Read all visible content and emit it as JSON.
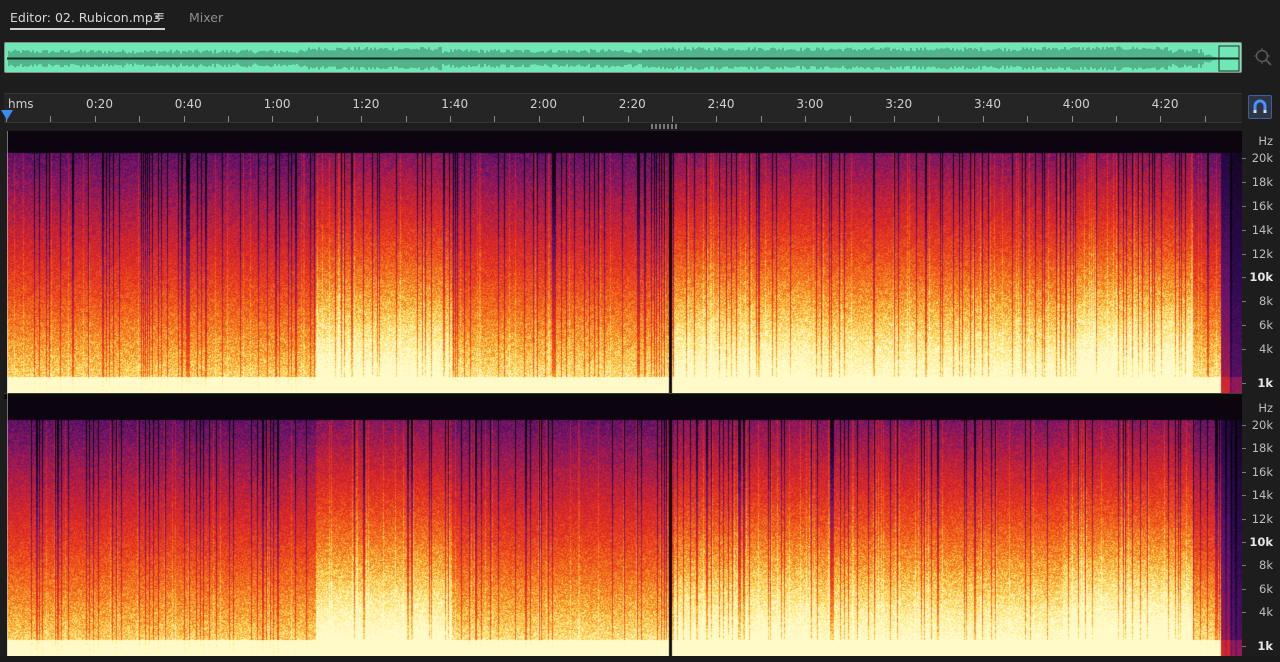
{
  "tabs": {
    "editor_label": "Editor: 02. Rubicon.mp3",
    "menu_glyph": "≡",
    "mixer_label": "Mixer"
  },
  "overview": {
    "color": "#6fe8b6",
    "zoom_icon": "zoom-navigator-icon"
  },
  "timeline": {
    "unit_label": "hms",
    "ticks": [
      "0:20",
      "0:40",
      "1:00",
      "1:20",
      "1:40",
      "2:00",
      "2:20",
      "2:40",
      "3:00",
      "3:20",
      "3:40",
      "4:00",
      "4:20"
    ],
    "playhead_color": "#3c8cf0"
  },
  "frequency_axis": {
    "unit": "Hz",
    "labels": [
      "20k",
      "18k",
      "16k",
      "14k",
      "12k",
      "10k",
      "8k",
      "6k",
      "4k",
      "1k"
    ]
  },
  "channel_1": {
    "label_unit": "Hz"
  },
  "channel_2": {
    "label_unit": "Hz"
  },
  "snap_icon": "snap-magnet-icon",
  "colors": {
    "accent": "#3c8cf0",
    "spectral_low": "#fff27a",
    "spectral_mid": "#e8301c",
    "spectral_high": "#3a1060"
  }
}
